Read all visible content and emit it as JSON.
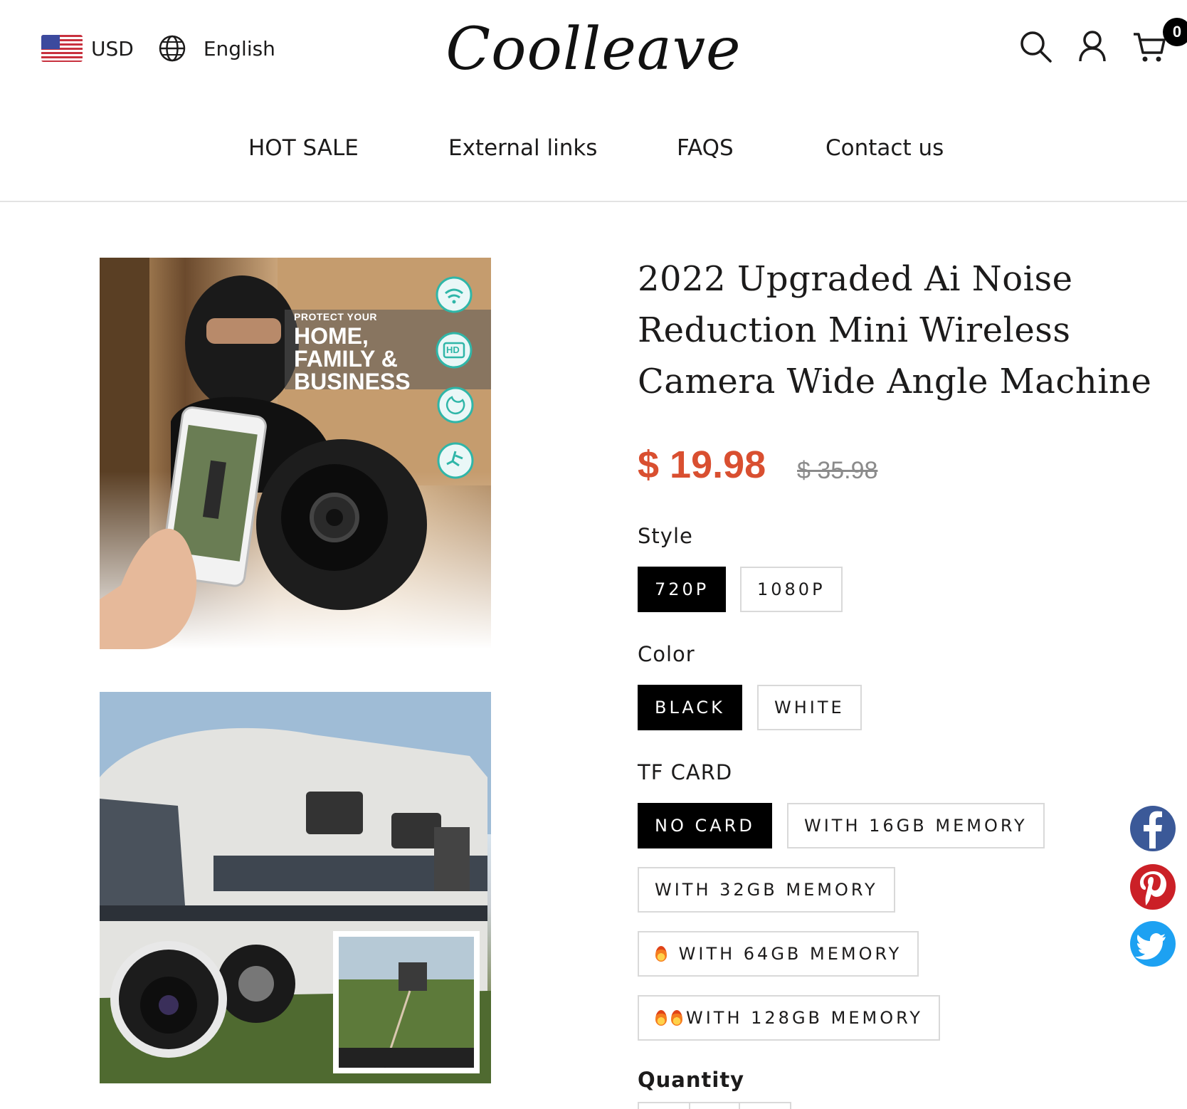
{
  "header": {
    "currency": "USD",
    "language": "English",
    "logo": "Coolleave",
    "cart_count": "0",
    "icons": [
      "us-flag-icon",
      "globe-icon",
      "search-icon",
      "account-icon",
      "cart-icon"
    ]
  },
  "nav": {
    "items": [
      {
        "label": "HOT SALE"
      },
      {
        "label": "External links"
      },
      {
        "label": "FAQS"
      },
      {
        "label": "Contact us"
      }
    ]
  },
  "product": {
    "title_lines": [
      "2022 Upgraded Ai Noise",
      "Reduction Mini Wireless",
      "Camera Wide Angle Machine"
    ],
    "price": "$ 19.98",
    "compare_price": "$ 35.98",
    "image1_text": {
      "line1": "PROTECT YOUR",
      "line2": "HOME,",
      "line3": "FAMILY &",
      "line4": "BUSINESS",
      "hd": "HD"
    },
    "options": {
      "style": {
        "label": "Style",
        "values": [
          "720P",
          "1080P"
        ],
        "selected": "720P"
      },
      "color": {
        "label": "Color",
        "values": [
          "BLACK",
          "WHITE"
        ],
        "selected": "BLACK"
      },
      "tf_card": {
        "label": "TF CARD",
        "values": [
          "NO CARD",
          "WITH 16GB MEMORY",
          "WITH 32GB MEMORY",
          "WITH 64GB MEMORY",
          "WITH 128GB MEMORY"
        ],
        "selected": "NO CARD"
      }
    },
    "quantity_label": "Quantity"
  },
  "social": [
    "facebook-icon",
    "pinterest-icon",
    "twitter-icon"
  ],
  "colors": {
    "accent_price": "#d94f30",
    "selected_option": "#000000",
    "facebook": "#3b5998",
    "pinterest": "#cb2027",
    "twitter": "#1da1f2"
  }
}
